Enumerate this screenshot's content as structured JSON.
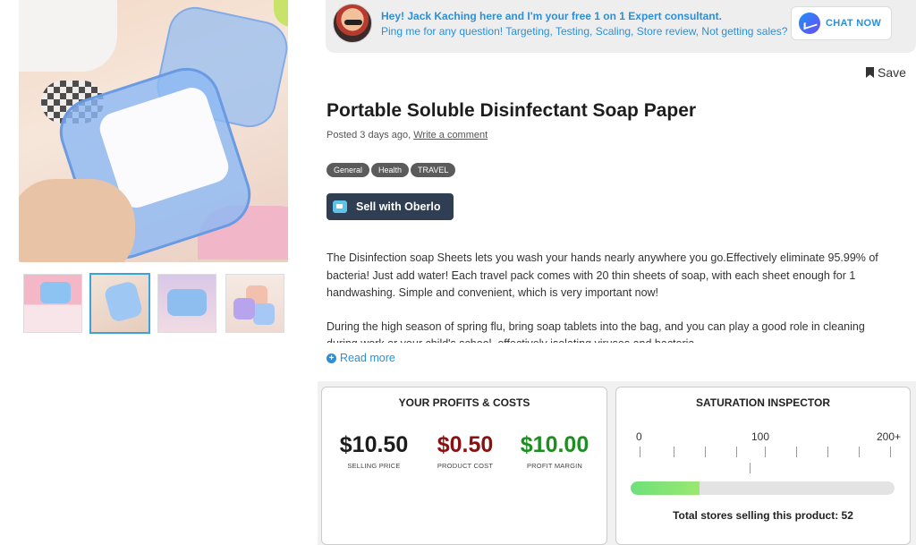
{
  "banner": {
    "line1": "Hey! Jack Kaching here and I'm your free 1 on 1 Expert consultant.",
    "line2": "Ping me for any question! Targeting, Testing, Scaling, Store review, Not getting sales?",
    "chat_label": "CHAT NOW"
  },
  "toolbar": {
    "save_label": "Save"
  },
  "product": {
    "title": "Portable Soluble Disinfectant Soap Paper",
    "posted": "Posted 3 days ago,",
    "comment_link": "Write a comment",
    "tags": [
      "General",
      "Health",
      "TRAVEL"
    ],
    "oberlo_label": "Sell with Oberlo",
    "description": [
      "The Disinfection soap Sheets lets you wash your hands nearly anywhere you go.Effectively eliminate 95.99% of bacteria! Just add water! Each travel pack comes with 20 thin sheets of soap, with each sheet enough for 1 handwashing. Simple and convenient, which is very important now!",
      "During the high season of spring flu, bring soap tablets into the bag, and you can play a good role in cleaning during work or your child's school, effectively isolating viruses and bacteria."
    ],
    "read_more": "Read more"
  },
  "profits": {
    "title": "YOUR PROFITS & COSTS",
    "selling_price": "$10.50",
    "selling_price_label": "SELLING PRICE",
    "product_cost": "$0.50",
    "product_cost_label": "PRODUCT COST",
    "profit_margin": "$10.00",
    "profit_margin_label": "PROFIT MARGIN"
  },
  "saturation": {
    "title": "SATURATION INSPECTOR",
    "scale_min": "0",
    "scale_mid": "100",
    "scale_max": "200+",
    "level_fraction": 0.26,
    "total_label": "Total stores selling this product: 52"
  },
  "colors": {
    "accent": "#2d8fd6",
    "cost": "#8b1111",
    "margin": "#1d8e21",
    "saturation_fill": "#6de07a"
  }
}
